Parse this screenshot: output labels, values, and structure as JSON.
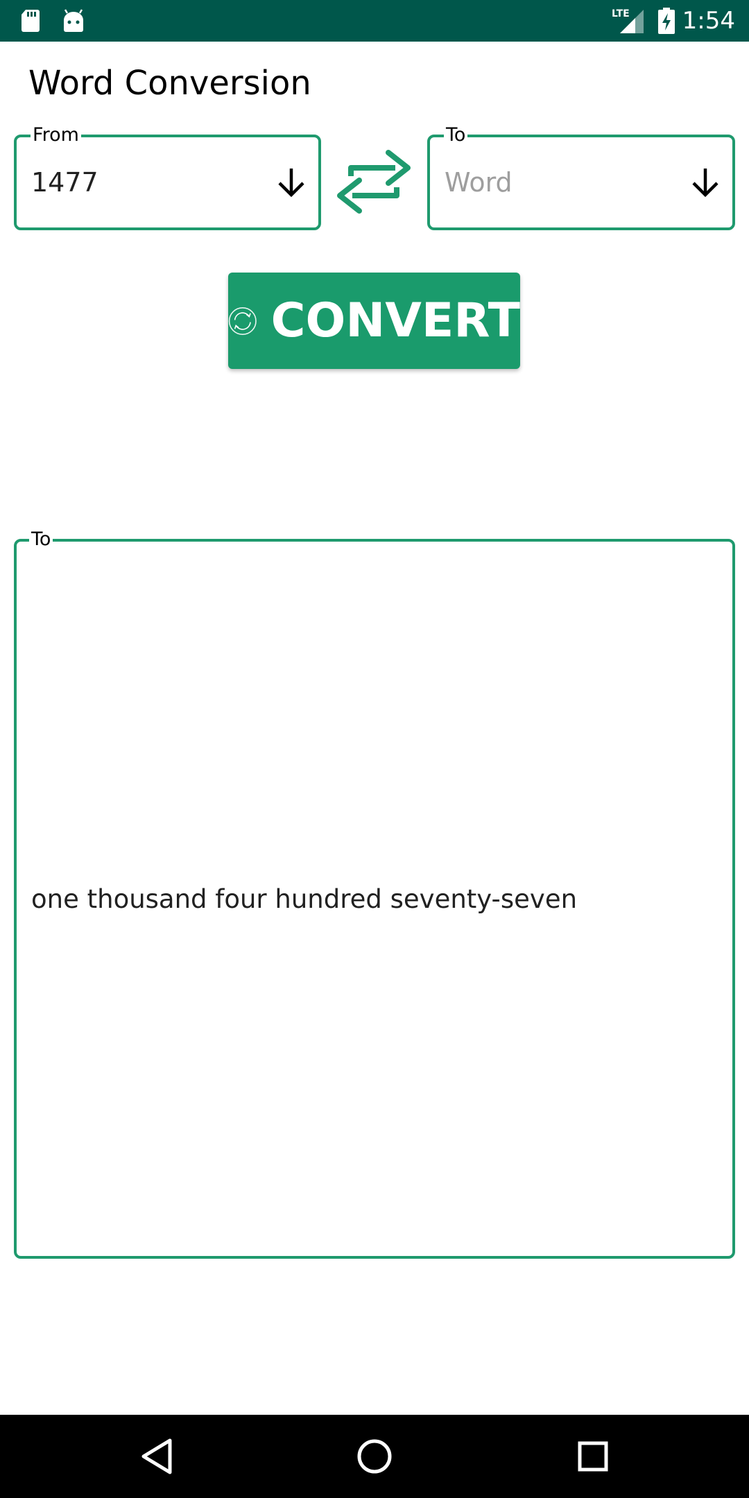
{
  "status_bar": {
    "time": "1:54",
    "network": "LTE",
    "icons": [
      "sd-card-icon",
      "android-icon",
      "lte-signal-icon",
      "battery-charging-icon"
    ],
    "background_color": "#00574b"
  },
  "header": {
    "title": "Word Conversion"
  },
  "from_field": {
    "legend": "From",
    "value": "1477",
    "icon": "arrow-down-icon"
  },
  "to_field": {
    "legend": "To",
    "placeholder": "Word",
    "icon": "arrow-down-icon"
  },
  "swap": {
    "icon": "swap-arrows-icon",
    "color": "#1f9a6e"
  },
  "convert_button": {
    "label": "CONVERT",
    "icon": "refresh-icon",
    "color": "#1a9b6c"
  },
  "result": {
    "legend": "To",
    "text": "one thousand four hundred seventy-seven",
    "border_color": "#1f9a6e"
  },
  "nav_bar": {
    "buttons": [
      "back-icon",
      "home-icon",
      "recents-icon"
    ]
  }
}
